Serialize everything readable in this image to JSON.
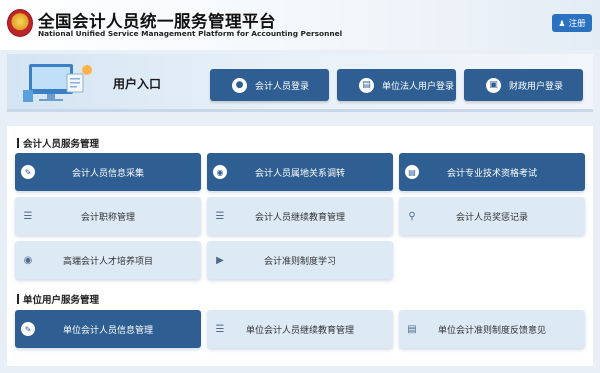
{
  "header": {
    "title": "全国会计人员统一服务管理平台",
    "subtitle": "National Unified Service Management Platform for Accounting Personnel",
    "register": {
      "icon": "user-icon",
      "label": "注册"
    }
  },
  "hero": {
    "title": "用户入口",
    "logins": [
      {
        "label": "会计人员登录",
        "icon": "person-icon"
      },
      {
        "label": "单位法人用户登录",
        "icon": "building-chart-icon"
      },
      {
        "label": "财政用户登录",
        "icon": "id-card-icon"
      }
    ]
  },
  "accountant_section": {
    "title": "会计人员服务管理",
    "tiles": [
      {
        "label": "会计人员信息采集",
        "icon": "edit-icon"
      },
      {
        "label": "会计人员属地关系调转",
        "icon": "location-icon"
      },
      {
        "label": "会计专业技术资格考试",
        "icon": "document-icon"
      },
      {
        "label": "会计职称管理",
        "icon": "list-icon"
      },
      {
        "label": "会计人员继续教育管理",
        "icon": "edit-list-icon"
      },
      {
        "label": "会计人员奖惩记录",
        "icon": "search-doc-icon"
      },
      {
        "label": "高端会计人才培养项目",
        "icon": "cap-icon"
      },
      {
        "label": "会计准则制度学习",
        "icon": "play-icon"
      }
    ]
  },
  "unit_section": {
    "title": "单位用户服务管理",
    "tiles": [
      {
        "label": "单位会计人员信息管理",
        "icon": "edit-icon"
      },
      {
        "label": "单位会计人员继续教育管理",
        "icon": "edit-list-icon"
      },
      {
        "label": "单位会计准则制度反馈意见",
        "icon": "feedback-icon"
      }
    ]
  }
}
